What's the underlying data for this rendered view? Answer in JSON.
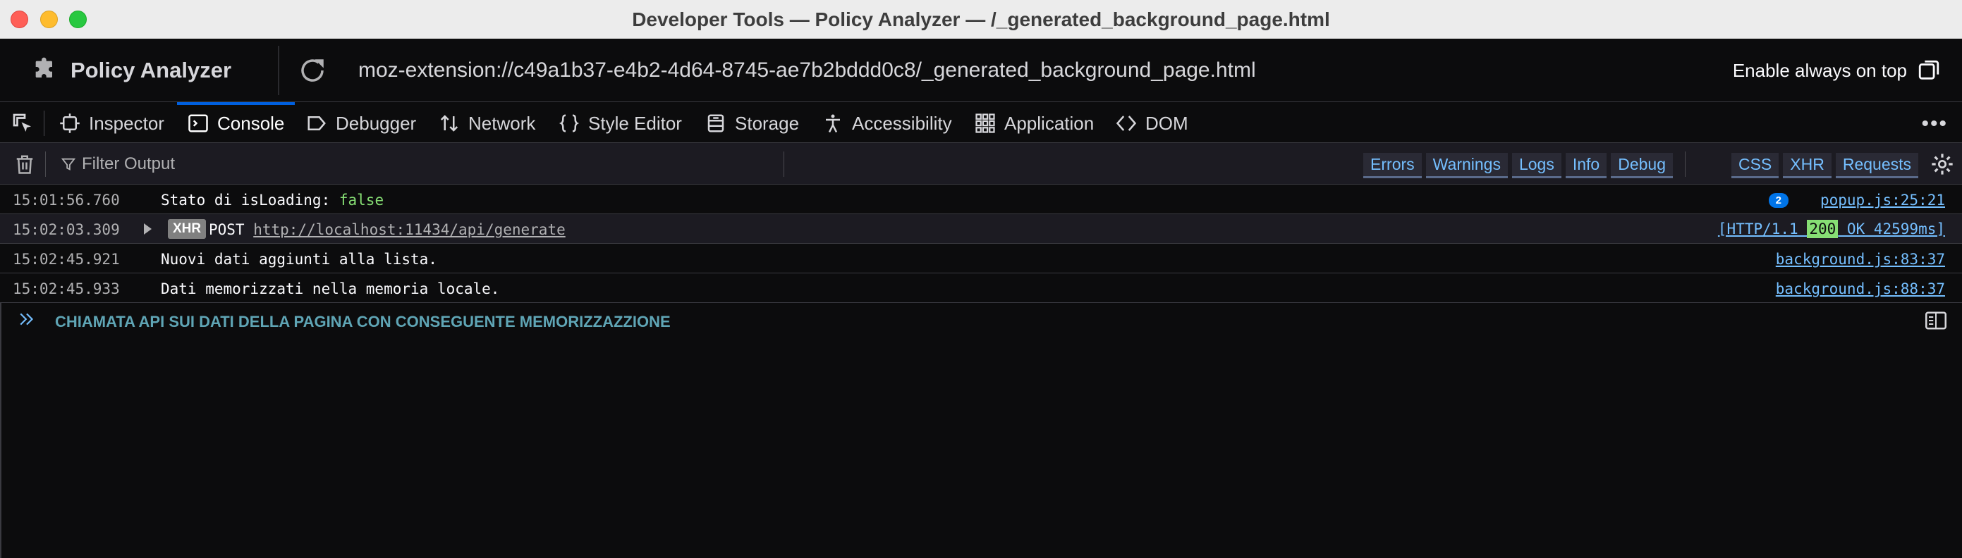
{
  "window": {
    "title": "Developer Tools — Policy Analyzer — /_generated_background_page.html"
  },
  "urlbar": {
    "extension_name": "Policy Analyzer",
    "url": "moz-extension://c49a1b37-e4b2-4d64-8745-ae7b2bddd0c8/_generated_background_page.html",
    "always_on_top_label": "Enable always on top"
  },
  "tabs": {
    "items": [
      {
        "label": "Inspector",
        "icon": "inspector-icon"
      },
      {
        "label": "Console",
        "icon": "console-icon",
        "active": true
      },
      {
        "label": "Debugger",
        "icon": "debugger-icon"
      },
      {
        "label": "Network",
        "icon": "network-icon"
      },
      {
        "label": "Style Editor",
        "icon": "style-editor-icon"
      },
      {
        "label": "Storage",
        "icon": "storage-icon"
      },
      {
        "label": "Accessibility",
        "icon": "accessibility-icon"
      },
      {
        "label": "Application",
        "icon": "application-icon"
      },
      {
        "label": "DOM",
        "icon": "dom-icon"
      }
    ],
    "more_label": "•••"
  },
  "console_toolbar": {
    "filter_placeholder": "Filter Output",
    "levels": [
      "Errors",
      "Warnings",
      "Logs",
      "Info",
      "Debug"
    ],
    "net_filters": [
      "CSS",
      "XHR",
      "Requests"
    ]
  },
  "logs": [
    {
      "time": "15:01:56.760",
      "message": "Stato di isLoading: ",
      "value": "false",
      "repeat": "2",
      "source": "popup.js:25:21"
    },
    {
      "time": "15:02:03.309",
      "tag": "XHR",
      "method": "POST ",
      "url": "http://localhost:11434/api/generate",
      "http_prefix": "[HTTP/1.1 ",
      "status": "200",
      "http_suffix": " OK 42599ms]"
    },
    {
      "time": "15:02:45.921",
      "message": "Nuovi dati aggiunti alla lista.",
      "source": "background.js:83:37"
    },
    {
      "time": "15:02:45.933",
      "message": "Dati memorizzati nella memoria locale.",
      "source": "background.js:88:37"
    }
  ],
  "input": {
    "text": "CHIAMATA API SUI DATI DELLA PAGINA CON CONSEGUENTE MEMORIZZAZZIONE"
  },
  "colors": {
    "accent": "#0060df",
    "link": "#75bfff",
    "bool": "#86de74",
    "input_text": "#5fa5b5"
  }
}
